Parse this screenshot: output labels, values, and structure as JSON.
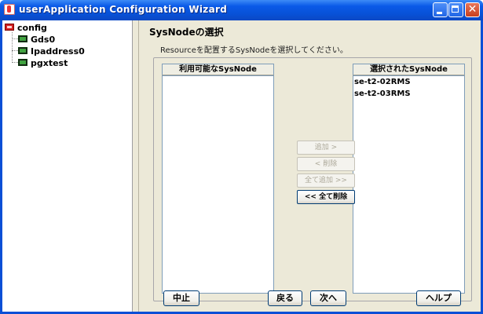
{
  "window": {
    "title": "userApplication Configuration Wizard",
    "close_glyph": "✕"
  },
  "tree": {
    "root": {
      "label": "config",
      "icon": "config-folder-icon"
    },
    "children": [
      {
        "label": "Gds0",
        "icon": "resource-icon"
      },
      {
        "label": "Ipaddress0",
        "icon": "resource-icon"
      },
      {
        "label": "pgxtest",
        "icon": "resource-icon"
      }
    ]
  },
  "page": {
    "title": "SysNodeの選択",
    "instruction": "Resourceを配置するSysNodeを選択してください。"
  },
  "available_list": {
    "header": "利用可能なSysNode",
    "items": []
  },
  "selected_list": {
    "header": "選択されたSysNode",
    "items": [
      "se-t2-02RMS",
      "se-t2-03RMS"
    ]
  },
  "transfer_buttons": {
    "add": "追加 >",
    "remove": "< 削除",
    "add_all": "全て追加 >>",
    "remove_all": "<< 全て削除"
  },
  "footer": {
    "cancel": "中止",
    "back": "戻る",
    "next": "次へ",
    "help": "ヘルプ"
  },
  "colors": {
    "titlebar": "#0a5ae8",
    "window_bg": "#ece9d8",
    "button_border": "#003c74"
  }
}
